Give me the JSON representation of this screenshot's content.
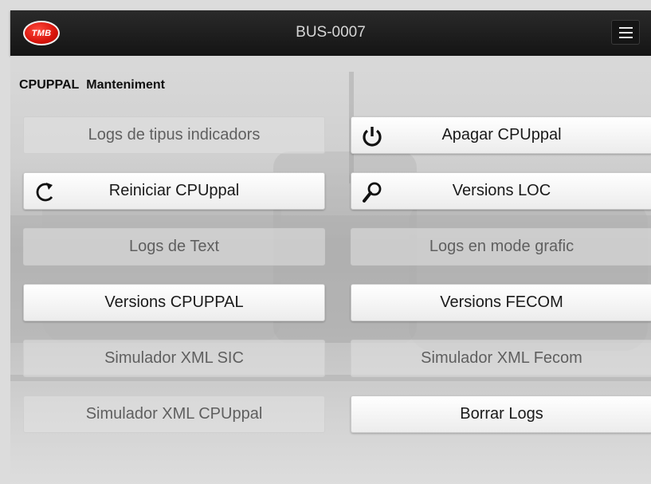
{
  "header": {
    "logo_text": "TMB",
    "title": "BUS-0007",
    "menu_icon": "hamburger-icon"
  },
  "page": {
    "section": "CPUPPAL",
    "subsection": "Manteniment"
  },
  "buttons": [
    {
      "label": "Logs de tipus indicadors",
      "state": "disabled",
      "icon": ""
    },
    {
      "label": "Apagar CPUppal",
      "state": "active",
      "icon": "power-icon"
    },
    {
      "label": "Reiniciar CPUppal",
      "state": "active",
      "icon": "refresh-icon"
    },
    {
      "label": "Versions LOC",
      "state": "active",
      "icon": "search-icon"
    },
    {
      "label": "Logs de Text",
      "state": "disabled",
      "icon": ""
    },
    {
      "label": "Logs en mode grafic",
      "state": "disabled",
      "icon": ""
    },
    {
      "label": "Versions CPUPPAL",
      "state": "active",
      "icon": ""
    },
    {
      "label": "Versions FECOM",
      "state": "active",
      "icon": ""
    },
    {
      "label": "Simulador XML SIC",
      "state": "disabled",
      "icon": ""
    },
    {
      "label": "Simulador XML Fecom",
      "state": "disabled",
      "icon": ""
    },
    {
      "label": "Simulador XML CPUppal",
      "state": "disabled",
      "icon": ""
    },
    {
      "label": "Borrar Logs",
      "state": "active",
      "icon": ""
    }
  ],
  "colors": {
    "topbar": "#1c1c1c",
    "logo_red": "#e0180d",
    "active_button": "#ffffff",
    "disabled_button": "#e2e2e2"
  }
}
